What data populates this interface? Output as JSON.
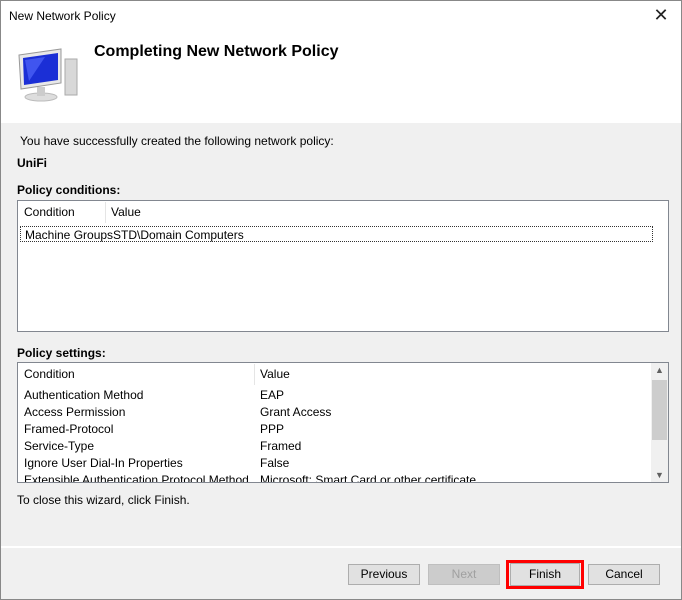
{
  "window": {
    "title": "New Network Policy",
    "close_icon": "close-icon"
  },
  "header": {
    "title": "Completing New Network Policy",
    "icon": "computer-monitor-icon"
  },
  "body": {
    "intro": "You have successfully created the following network policy:",
    "policy_name": "UniFi",
    "conditions_label": "Policy conditions:",
    "conditions": {
      "columns": [
        "Condition",
        "Value"
      ],
      "rows": [
        [
          "Machine Groups",
          "STD\\Domain Computers"
        ]
      ]
    },
    "settings_label": "Policy settings:",
    "settings": {
      "columns": [
        "Condition",
        "Value"
      ],
      "rows": [
        [
          "Authentication Method",
          "EAP"
        ],
        [
          "Access Permission",
          "Grant Access"
        ],
        [
          "Framed-Protocol",
          "PPP"
        ],
        [
          "Service-Type",
          "Framed"
        ],
        [
          "Ignore User Dial-In Properties",
          "False"
        ],
        [
          "Extensible Authentication Protocol Method",
          "Microsoft: Smart Card or other certificate"
        ]
      ]
    },
    "close_text": "To close this wizard, click Finish."
  },
  "buttons": {
    "previous": "Previous",
    "next": "Next",
    "finish": "Finish",
    "cancel": "Cancel"
  },
  "highlight_color": "#ff0000"
}
